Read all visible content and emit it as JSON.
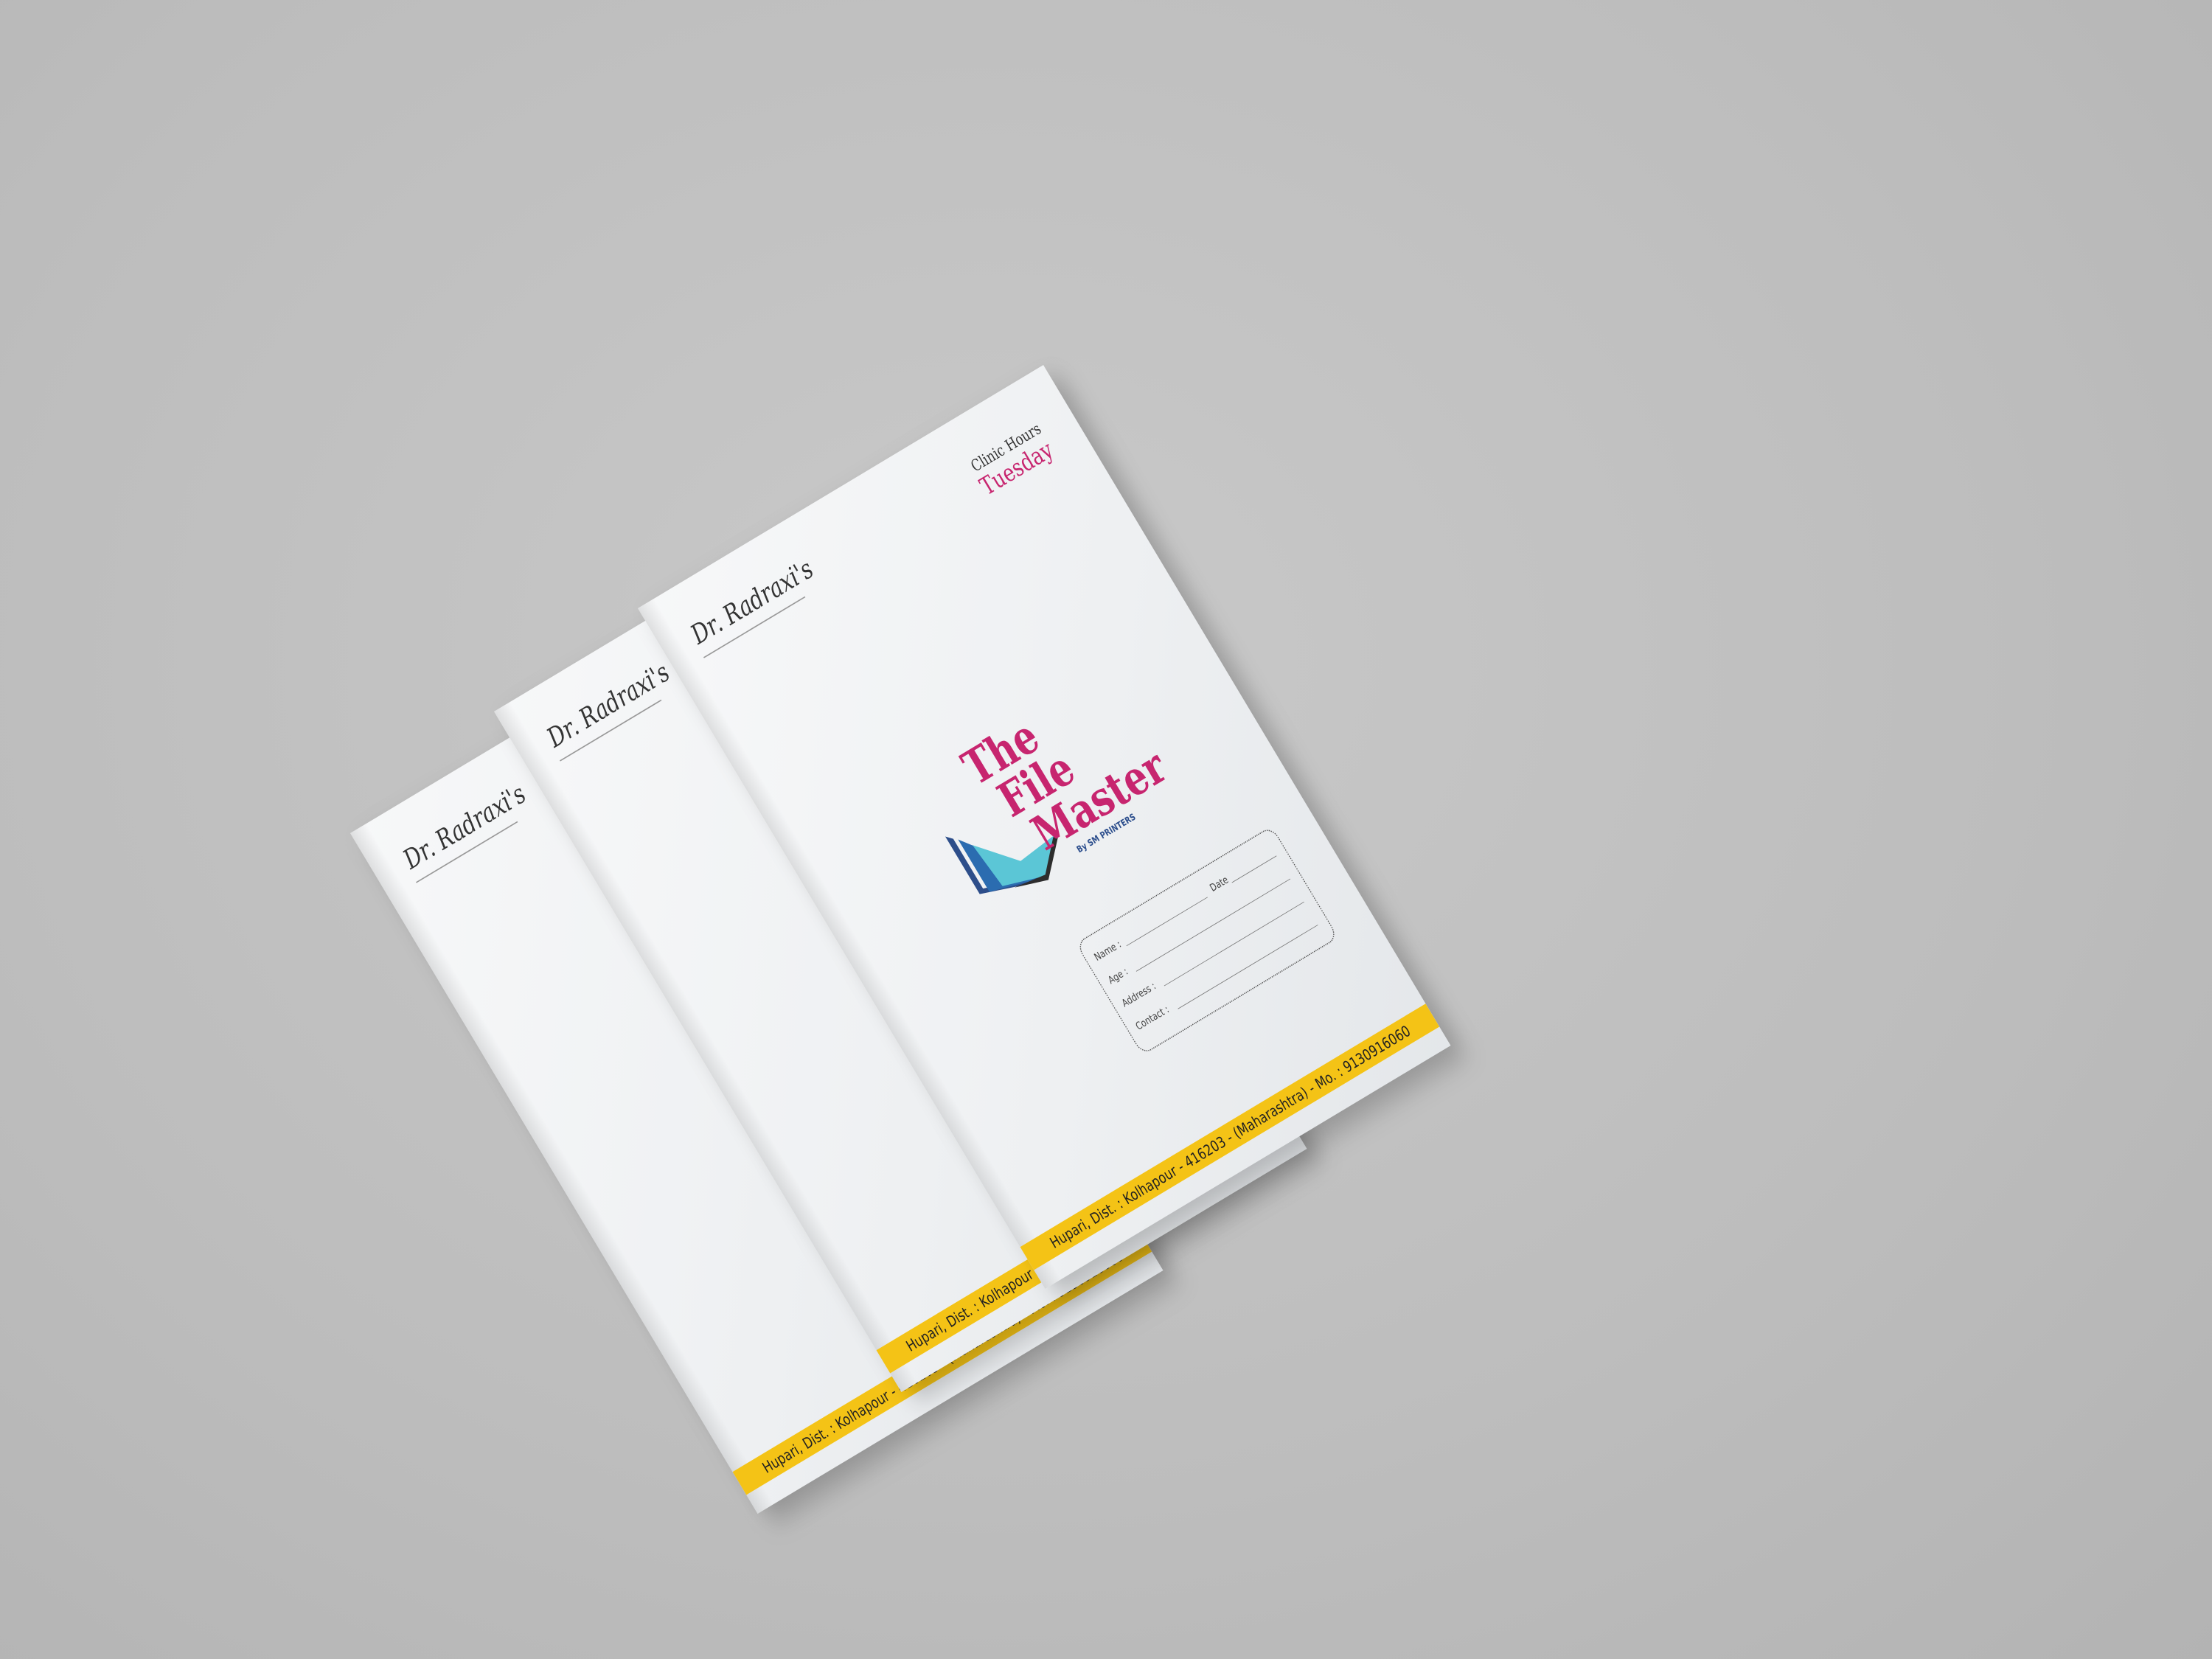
{
  "booklet": {
    "doctor_name": "Dr. Radraxi's",
    "clinic_hours_label": "Clinic Hours",
    "clinic_day": "Tuesday",
    "logo": {
      "word1": "The",
      "word2": "File",
      "word3": "Master",
      "by_line": "By SM PRINTERS"
    },
    "form": {
      "name_label": "Name :",
      "date_label": "Date",
      "age_label": "Age :",
      "address_label": "Address :",
      "contact_label": "Contact :"
    },
    "footer": "Hupari, Dist. : Kolhapour - 416203 - (Maharashtra) - Mo. : 9130916060"
  },
  "colors": {
    "background": "#bdbdbd",
    "accent_magenta": "#c7256f",
    "band_yellow": "#f4c316",
    "logo_blue": "#2b6cb0",
    "logo_cyan": "#5bc6d6",
    "logo_dark": "#2d2d2d"
  }
}
